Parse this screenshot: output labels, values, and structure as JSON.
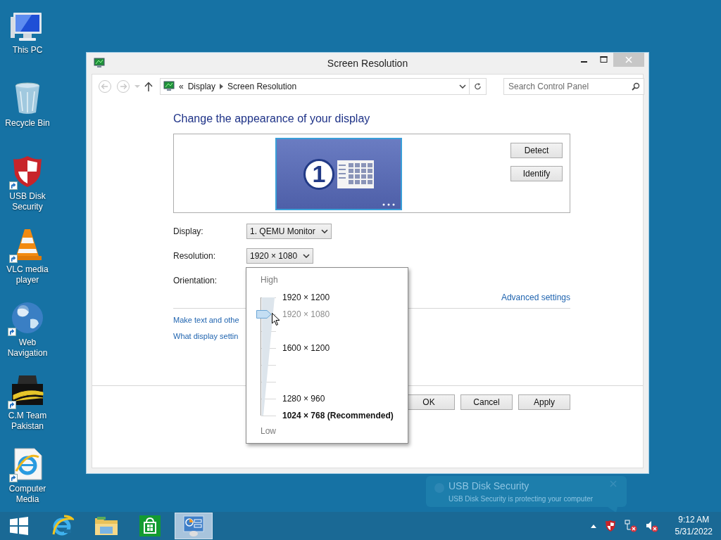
{
  "desktop_icons": [
    {
      "label": "This PC",
      "kind": "computer",
      "shortcut": false
    },
    {
      "label": "Recycle Bin",
      "kind": "recycle-bin",
      "shortcut": false
    },
    {
      "label": "USB Disk Security",
      "kind": "shield",
      "shortcut": true
    },
    {
      "label": "VLC media player",
      "kind": "cone",
      "shortcut": true
    },
    {
      "label": "Web Navigation",
      "kind": "globe",
      "shortcut": true
    },
    {
      "label": "C.M Team Pakistan",
      "kind": "hat",
      "shortcut": true
    },
    {
      "label": "Computer Media",
      "kind": "browser-document",
      "shortcut": true
    }
  ],
  "window": {
    "title": "Screen Resolution",
    "address": {
      "overflow_mark": "«",
      "breadcrumb": [
        "Display",
        "Screen Resolution"
      ]
    },
    "search": {
      "placeholder": "Search Control Panel"
    },
    "heading": "Change the appearance of your display",
    "monitor": {
      "number": "1"
    },
    "side_buttons": [
      "Detect",
      "Identify"
    ],
    "fields": [
      {
        "label": "Display:",
        "value": "1. QEMU Monitor"
      },
      {
        "label": "Resolution:",
        "value": "1920 × 1080"
      },
      {
        "label": "Orientation:"
      }
    ],
    "advanced_link": "Advanced settings",
    "links": [
      "Make text and othe",
      "What display settin"
    ],
    "dialog_buttons": [
      "OK",
      "Cancel",
      "Apply"
    ]
  },
  "resolution_popup": {
    "high": "High",
    "low": "Low",
    "level": 0.857,
    "stops": [
      {
        "kind": "labeled",
        "label": "1920 × 1200",
        "selected": false,
        "recommended": false
      },
      {
        "kind": "labeled",
        "label": "1920 × 1080",
        "selected": true,
        "recommended": false
      },
      {
        "kind": "tick",
        "selected": false
      },
      {
        "kind": "labeled",
        "label": "1600 × 1200",
        "selected": false,
        "recommended": false
      },
      {
        "kind": "tick",
        "selected": false
      },
      {
        "kind": "tick",
        "selected": false
      },
      {
        "kind": "labeled",
        "label": "1280 × 960",
        "selected": false,
        "recommended": false
      },
      {
        "kind": "labeled",
        "label": "1024 × 768 (Recommended)",
        "selected": false,
        "recommended": true
      }
    ]
  },
  "notification": {
    "title": "USB Disk Security",
    "message": "USB Disk Security is protecting your computer"
  },
  "taskbar": {
    "items": [
      {
        "kind": "start",
        "selected": false
      },
      {
        "kind": "browser",
        "selected": false
      },
      {
        "kind": "folder",
        "selected": false
      },
      {
        "kind": "store",
        "selected": false
      },
      {
        "kind": "control-panel",
        "selected": true
      }
    ],
    "clock": {
      "time": "9:12 AM",
      "date": "5/31/2022"
    }
  }
}
